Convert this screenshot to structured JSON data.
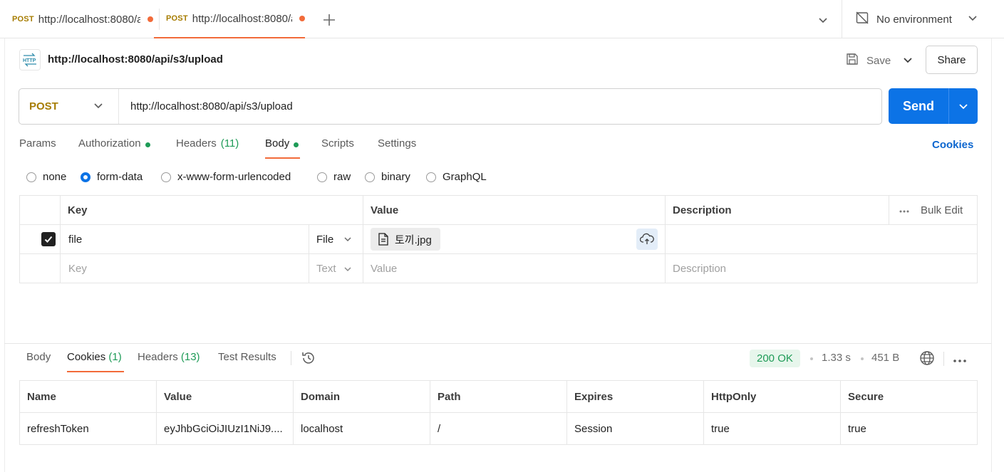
{
  "tabs": [
    {
      "method": "POST",
      "url": "http://localhost:8080/a"
    },
    {
      "method": "POST",
      "url": "http://localhost:8080/a"
    }
  ],
  "environment": {
    "label": "No environment"
  },
  "request": {
    "title": "http://localhost:8080/api/s3/upload",
    "save_label": "Save",
    "share_label": "Share",
    "method": "POST",
    "url": "http://localhost:8080/api/s3/upload",
    "send_label": "Send"
  },
  "request_tabs": {
    "params": "Params",
    "authorization": "Authorization",
    "headers": "Headers",
    "headers_count": "(11)",
    "body": "Body",
    "scripts": "Scripts",
    "settings": "Settings",
    "cookies_link": "Cookies"
  },
  "body_types": {
    "none": "none",
    "form_data": "form-data",
    "urlencoded": "x-www-form-urlencoded",
    "raw": "raw",
    "binary": "binary",
    "graphql": "GraphQL",
    "selected": "form-data"
  },
  "form_table": {
    "headers": {
      "key": "Key",
      "value": "Value",
      "description": "Description",
      "bulk_edit": "Bulk Edit"
    },
    "row": {
      "key": "file",
      "type": "File",
      "file_name": "토끼.jpg"
    },
    "empty_row": {
      "key_placeholder": "Key",
      "type": "Text",
      "value_placeholder": "Value",
      "description_placeholder": "Description"
    }
  },
  "response": {
    "tabs": {
      "body": "Body",
      "cookies": "Cookies",
      "cookies_count": "(1)",
      "headers": "Headers",
      "headers_count": "(13)",
      "test_results": "Test Results"
    },
    "status": "200 OK",
    "time": "1.33 s",
    "size": "451 B",
    "cookies_table": {
      "columns": [
        "Name",
        "Value",
        "Domain",
        "Path",
        "Expires",
        "HttpOnly",
        "Secure"
      ],
      "rows": [
        [
          "refreshToken",
          "eyJhbGciOiJIUzI1NiJ9....",
          "localhost",
          "/",
          "Session",
          "true",
          "true"
        ]
      ]
    }
  },
  "colors": {
    "accent_orange": "#f26b3a",
    "method_post": "#a67c00",
    "send_blue": "#0c73e6",
    "success_green": "#1e9b57"
  }
}
